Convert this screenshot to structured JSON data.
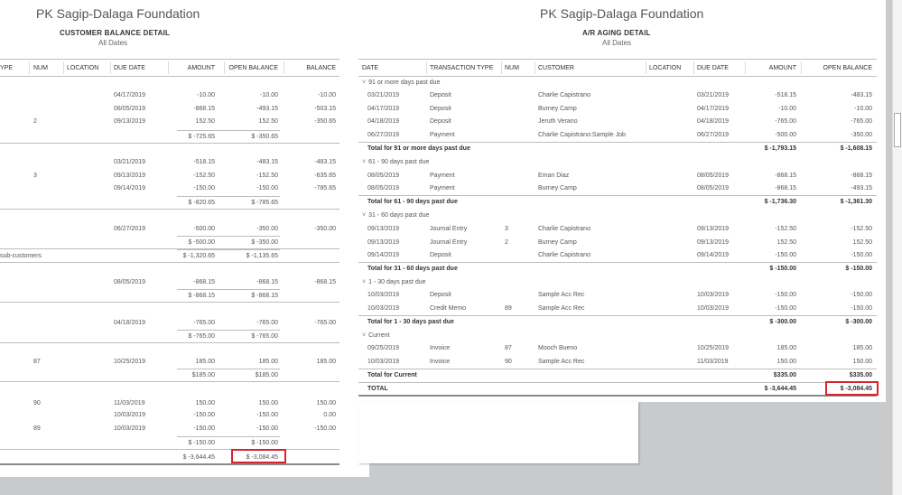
{
  "left": {
    "company": "PK Sagip-Dalaga Foundation",
    "title": "CUSTOMER BALANCE DETAIL",
    "subtitle": "All Dates",
    "columns": [
      "YPE",
      "NUM",
      "LOCATION",
      "DUE DATE",
      "AMOUNT",
      "OPEN BALANCE",
      "BALANCE"
    ],
    "rows": [
      {
        "type": "detail",
        "num": "",
        "due": "04/17/2019",
        "amount": "-10.00",
        "open": "-10.00",
        "balance": "-10.00"
      },
      {
        "type": "detail",
        "num": "",
        "due": "08/05/2019",
        "amount": "-868.15",
        "open": "-493.15",
        "balance": "-503.15"
      },
      {
        "type": "detail",
        "num": "2",
        "due": "09/13/2019",
        "amount": "152.50",
        "open": "152.50",
        "balance": "-350.65"
      },
      {
        "type": "total",
        "amount": "$ -725.65",
        "open": "$ -350.65"
      },
      {
        "type": "detail",
        "num": "",
        "due": "03/21/2019",
        "amount": "-518.15",
        "open": "-483.15",
        "balance": "-483.15"
      },
      {
        "type": "detail",
        "num": "3",
        "due": "09/13/2019",
        "amount": "-152.50",
        "open": "-152.50",
        "balance": "-635.65"
      },
      {
        "type": "detail",
        "num": "",
        "due": "09/14/2019",
        "amount": "-150.00",
        "open": "-150.00",
        "balance": "-785.65"
      },
      {
        "type": "total",
        "amount": "$ -820.65",
        "open": "$ -785.65"
      },
      {
        "type": "detail",
        "num": "",
        "due": "06/27/2019",
        "amount": "-500.00",
        "open": "-350.00",
        "balance": "-350.00"
      },
      {
        "type": "total",
        "amount": "$ -500.00",
        "open": "$ -350.00"
      },
      {
        "type": "group",
        "label": "sub-customers",
        "amount": "$ -1,320.65",
        "open": "$ -1,135.65"
      },
      {
        "type": "detail",
        "num": "",
        "due": "08/05/2019",
        "amount": "-868.15",
        "open": "-868.15",
        "balance": "-868.15"
      },
      {
        "type": "total",
        "amount": "$ -868.15",
        "open": "$ -868.15"
      },
      {
        "type": "detail",
        "num": "",
        "due": "04/18/2019",
        "amount": "-765.00",
        "open": "-765.00",
        "balance": "-765.00"
      },
      {
        "type": "total",
        "amount": "$ -765.00",
        "open": "$ -765.00"
      },
      {
        "type": "detail",
        "num": "87",
        "due": "10/25/2019",
        "amount": "185.00",
        "open": "185.00",
        "balance": "185.00"
      },
      {
        "type": "total",
        "amount": "$185.00",
        "open": "$185.00"
      },
      {
        "type": "detail",
        "num": "90",
        "due": "11/03/2019",
        "amount": "150.00",
        "open": "150.00",
        "balance": "150.00"
      },
      {
        "type": "detail",
        "num": "",
        "due": "10/03/2019",
        "amount": "-150.00",
        "open": "-150.00",
        "balance": "0.00"
      },
      {
        "type": "detail",
        "num": "89",
        "due": "10/03/2019",
        "amount": "-150.00",
        "open": "-150.00",
        "balance": "-150.00"
      },
      {
        "type": "total",
        "amount": "$ -150.00",
        "open": "$ -150.00"
      },
      {
        "type": "grand",
        "amount": "$ -3,644.45",
        "open": "$ -3,084.45"
      }
    ]
  },
  "right": {
    "company": "PK Sagip-Dalaga Foundation",
    "title": "A/R AGING DETAIL",
    "subtitle": "All Dates",
    "columns": [
      "DATE",
      "TRANSACTION TYPE",
      "NUM",
      "CUSTOMER",
      "LOCATION",
      "DUE DATE",
      "AMOUNT",
      "OPEN BALANCE"
    ],
    "rows": [
      {
        "type": "section",
        "label": "91 or more days past due"
      },
      {
        "type": "detail",
        "date": "03/21/2019",
        "tx": "Deposit",
        "num": "",
        "customer": "Charlie Capistrano",
        "due": "03/21/2019",
        "amount": "-518.15",
        "open": "-483.15"
      },
      {
        "type": "detail",
        "date": "04/17/2019",
        "tx": "Deposit",
        "num": "",
        "customer": "Burney Camp",
        "due": "04/17/2019",
        "amount": "-10.00",
        "open": "-10.00"
      },
      {
        "type": "detail",
        "date": "04/18/2019",
        "tx": "Deposit",
        "num": "",
        "customer": "Jeruth Verano",
        "due": "04/18/2019",
        "amount": "-765.00",
        "open": "-765.00"
      },
      {
        "type": "detail",
        "date": "06/27/2019",
        "tx": "Payment",
        "num": "",
        "customer": "Charlie Capistrano:Sample Job",
        "due": "06/27/2019",
        "amount": "-500.00",
        "open": "-350.00"
      },
      {
        "type": "total",
        "label": "Total for 91 or more days past due",
        "amount": "$ -1,793.15",
        "open": "$ -1,608.15"
      },
      {
        "type": "section",
        "label": "61 - 90 days past due"
      },
      {
        "type": "detail",
        "date": "08/05/2019",
        "tx": "Payment",
        "num": "",
        "customer": "Eman Diaz",
        "due": "08/05/2019",
        "amount": "-868.15",
        "open": "-868.15"
      },
      {
        "type": "detail",
        "date": "08/05/2019",
        "tx": "Payment",
        "num": "",
        "customer": "Burney Camp",
        "due": "08/05/2019",
        "amount": "-868.15",
        "open": "-493.15"
      },
      {
        "type": "total",
        "label": "Total for 61 - 90 days past due",
        "amount": "$ -1,736.30",
        "open": "$ -1,361.30"
      },
      {
        "type": "section",
        "label": "31 - 60 days past due"
      },
      {
        "type": "detail",
        "date": "09/13/2019",
        "tx": "Journal Entry",
        "num": "3",
        "customer": "Charlie Capistrano",
        "due": "09/13/2019",
        "amount": "-152.50",
        "open": "-152.50"
      },
      {
        "type": "detail",
        "date": "09/13/2019",
        "tx": "Journal Entry",
        "num": "2",
        "customer": "Burney Camp",
        "due": "09/13/2019",
        "amount": "152.50",
        "open": "152.50"
      },
      {
        "type": "detail",
        "date": "09/14/2019",
        "tx": "Deposit",
        "num": "",
        "customer": "Charlie Capistrano",
        "due": "09/14/2019",
        "amount": "-150.00",
        "open": "-150.00"
      },
      {
        "type": "total",
        "label": "Total for 31 - 60 days past due",
        "amount": "$ -150.00",
        "open": "$ -150.00"
      },
      {
        "type": "section",
        "label": "1 - 30 days past due"
      },
      {
        "type": "detail",
        "date": "10/03/2019",
        "tx": "Deposit",
        "num": "",
        "customer": "Sample Acc Rec",
        "due": "10/03/2019",
        "amount": "-150.00",
        "open": "-150.00"
      },
      {
        "type": "detail",
        "date": "10/03/2019",
        "tx": "Credit Memo",
        "num": "89",
        "customer": "Sample Acc Rec",
        "due": "10/03/2019",
        "amount": "-150.00",
        "open": "-150.00"
      },
      {
        "type": "total",
        "label": "Total for 1 - 30 days past due",
        "amount": "$ -300.00",
        "open": "$ -300.00"
      },
      {
        "type": "section",
        "label": "Current"
      },
      {
        "type": "detail",
        "date": "09/25/2019",
        "tx": "Invoice",
        "num": "87",
        "customer": "Mooch Bueno",
        "due": "10/25/2019",
        "amount": "185.00",
        "open": "185.00"
      },
      {
        "type": "detail",
        "date": "10/03/2019",
        "tx": "Invoice",
        "num": "90",
        "customer": "Sample Acc Rec",
        "due": "11/03/2019",
        "amount": "150.00",
        "open": "150.00"
      },
      {
        "type": "total",
        "label": "Total for Current",
        "amount": "$335.00",
        "open": "$335.00"
      },
      {
        "type": "grand",
        "label": "TOTAL",
        "amount": "$ -3,644.45",
        "open": "$ -3,084.45"
      }
    ]
  },
  "icons": {
    "caret": "caret-down-icon"
  },
  "colors": {
    "highlight": "#d9232e",
    "text": "#444444"
  }
}
